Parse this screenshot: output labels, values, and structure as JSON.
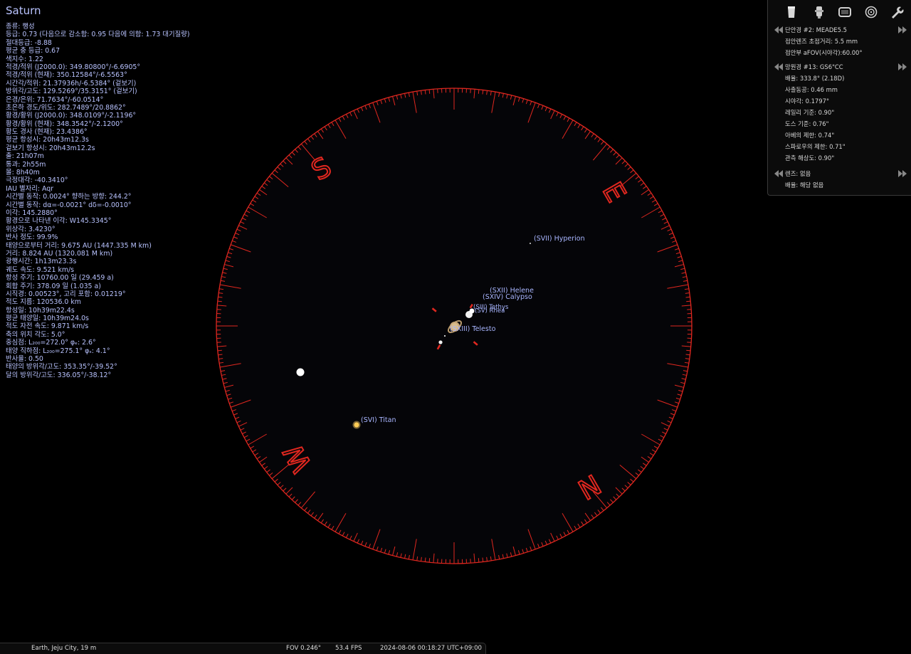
{
  "object_title": "Saturn",
  "info_lines": [
    "종류: 행성",
    "등급: 0.73 (다음으로 감소함: 0.95 다음에 의함: 1.73 대기질량)",
    "절대등급: -8.88",
    "평균 충 등급: 0.67",
    "색지수: 1.22",
    "적경/적위 (J2000.0): 349.80800°/-6.6905°",
    "적경/적위 (현재): 350.12584°/-6.5563°",
    "시간각/적위: 21.37936h/-6.5384° (겉보기)",
    "방위각/고도: 129.5269°/35.3151° (겉보기)",
    "은경/은위: 71.7634°/-60.0514°",
    "초은하 경도/위도: 282.7489°/20.8862°",
    "황경/황위 (J2000.0): 348.0109°/-2.1196°",
    "황경/황위 (현재): 348.3542°/-2.1200°",
    "황도 경사 (현재): 23.4386°",
    "평균 항성시: 20h43m12.3s",
    "겉보기 항성시: 20h43m12.2s",
    "출: 21h07m",
    "통과: 2h55m",
    "몰: 8h40m",
    "극정대각: -40.3410°",
    "IAU 별자리: Aqr",
    "시간별 동작: 0.0024° 향하는 방향: 244.2°",
    "시간별 동작: dα=-0.0021° dδ=-0.0010°",
    "이각: 145.2880°",
    "황경으로 나타낸 이각: W145.3345°",
    "위상각: 3.4230°",
    "반사 정도: 99.9%",
    "태양으로부터 거리: 9.675 AU (1447.335 M km)",
    "거리: 8.824 AU (1320.081 M km)",
    "광행시간: 1h13m23.3s",
    "궤도 속도: 9.521 km/s",
    "항성 주기: 10760.00 일 (29.459 a)",
    "회합 주기: 378.09 일 (1.035 a)",
    "시직경: 0.00523°, 고리 포함: 0.01219°",
    "적도 지름: 120536.0 km",
    "항성일: 10h39m22.4s",
    "평균 태양일: 10h39m24.0s",
    "적도 자전 속도: 9.871 km/s",
    "축의 위치 각도: 5.0°",
    "중심점: L₂₀₀=272.0° φₑ: 2.6°",
    "태양 직하점: L₂₀₀=275.1° φₛ: 4.1°",
    "반사율: 0.50",
    "태양의 방위각/고도: 353.35°/-39.52°",
    "달의 방위각/고도: 336.05°/-38.12°"
  ],
  "compass_labels": {
    "S": "S",
    "E": "E",
    "W": "W",
    "N": "N"
  },
  "moon_labels": {
    "hyperion": "(SVII) Hyperion",
    "helene": "(SXII) Helene",
    "calypso": "(SXIV) Calypso",
    "tethys": "(SIII) Tethys",
    "rhea": "(SV) Rhea",
    "telesto": "(SXIII) Telesto",
    "titan": "(SVI) Titan"
  },
  "ocular_panel": {
    "eyepiece": {
      "header": "단안경 #2: MEADE5.5",
      "focal": "접안렌즈 초점거리: 5.5 mm",
      "afov": "접안부 aFOV(시야각):60.00°"
    },
    "telescope": {
      "header": "망원경 #13: GS6\"CC",
      "lines": [
        "배율: 333.8° (2.18D)",
        "사출동공: 0.46 mm",
        "시야각: 0.1797°",
        "레일리 기준: 0.90\"",
        "도스 기준: 0.76\"",
        "아베의 제한: 0.74\"",
        "스파로우의 제한: 0.71\"",
        "관측 해상도: 0.90\""
      ]
    },
    "lens": {
      "header": "렌즈: 없음",
      "mag": "배율: 해당 없음"
    }
  },
  "status_bar": {
    "location": "Earth, Jeju City, 19 m",
    "fov": "FOV 0.246°",
    "fps": "53.4 FPS",
    "datetime": "2024-08-06 00:18:27 UTC+09:00"
  },
  "colors": {
    "compass": "#e0271f",
    "label": "#a9b6ff",
    "info_text": "#b9c3ff"
  }
}
